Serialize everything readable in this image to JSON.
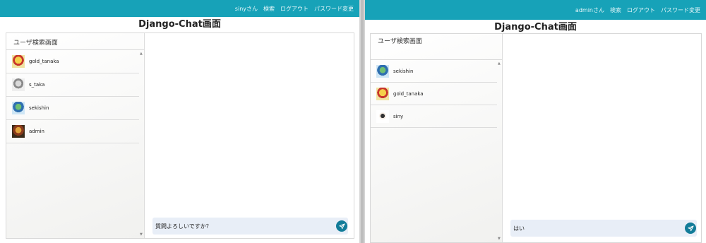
{
  "left_window": {
    "nav": [
      "sinyさん",
      "検索",
      "ログアウト",
      "パスワード変更"
    ],
    "title": "Django-Chat画面",
    "sidebar_title": "ユーザ検索画面",
    "users": [
      {
        "name": "gold_tanaka",
        "avatar": "gold-avatar-icon"
      },
      {
        "name": "s_taka",
        "avatar": "white-helmet-avatar-icon"
      },
      {
        "name": "sekishin",
        "avatar": "green-hair-avatar-icon"
      },
      {
        "name": "admin",
        "avatar": "dark-armor-avatar-icon"
      }
    ],
    "message_value": "質問よろしいですか？"
  },
  "right_window": {
    "nav": [
      "adminさん",
      "検索",
      "ログアウト",
      "パスワード変更"
    ],
    "title": "Django-Chat画面",
    "sidebar_title": "ユーザ検索画面",
    "users": [
      {
        "name": "sekishin",
        "avatar": "green-hair-avatar-icon"
      },
      {
        "name": "gold_tanaka",
        "avatar": "gold-avatar-icon"
      },
      {
        "name": "siny",
        "avatar": "small-person-avatar-icon"
      }
    ],
    "message_value": "はい"
  },
  "colors": {
    "navbar": "#17a2b8",
    "send_button": "#127c99",
    "message_bar": "#e8eef7"
  },
  "icons": {
    "send": "paper-plane-icon",
    "scroll_up": "scroll-up-arrow-icon",
    "scroll_down": "scroll-down-arrow-icon"
  }
}
